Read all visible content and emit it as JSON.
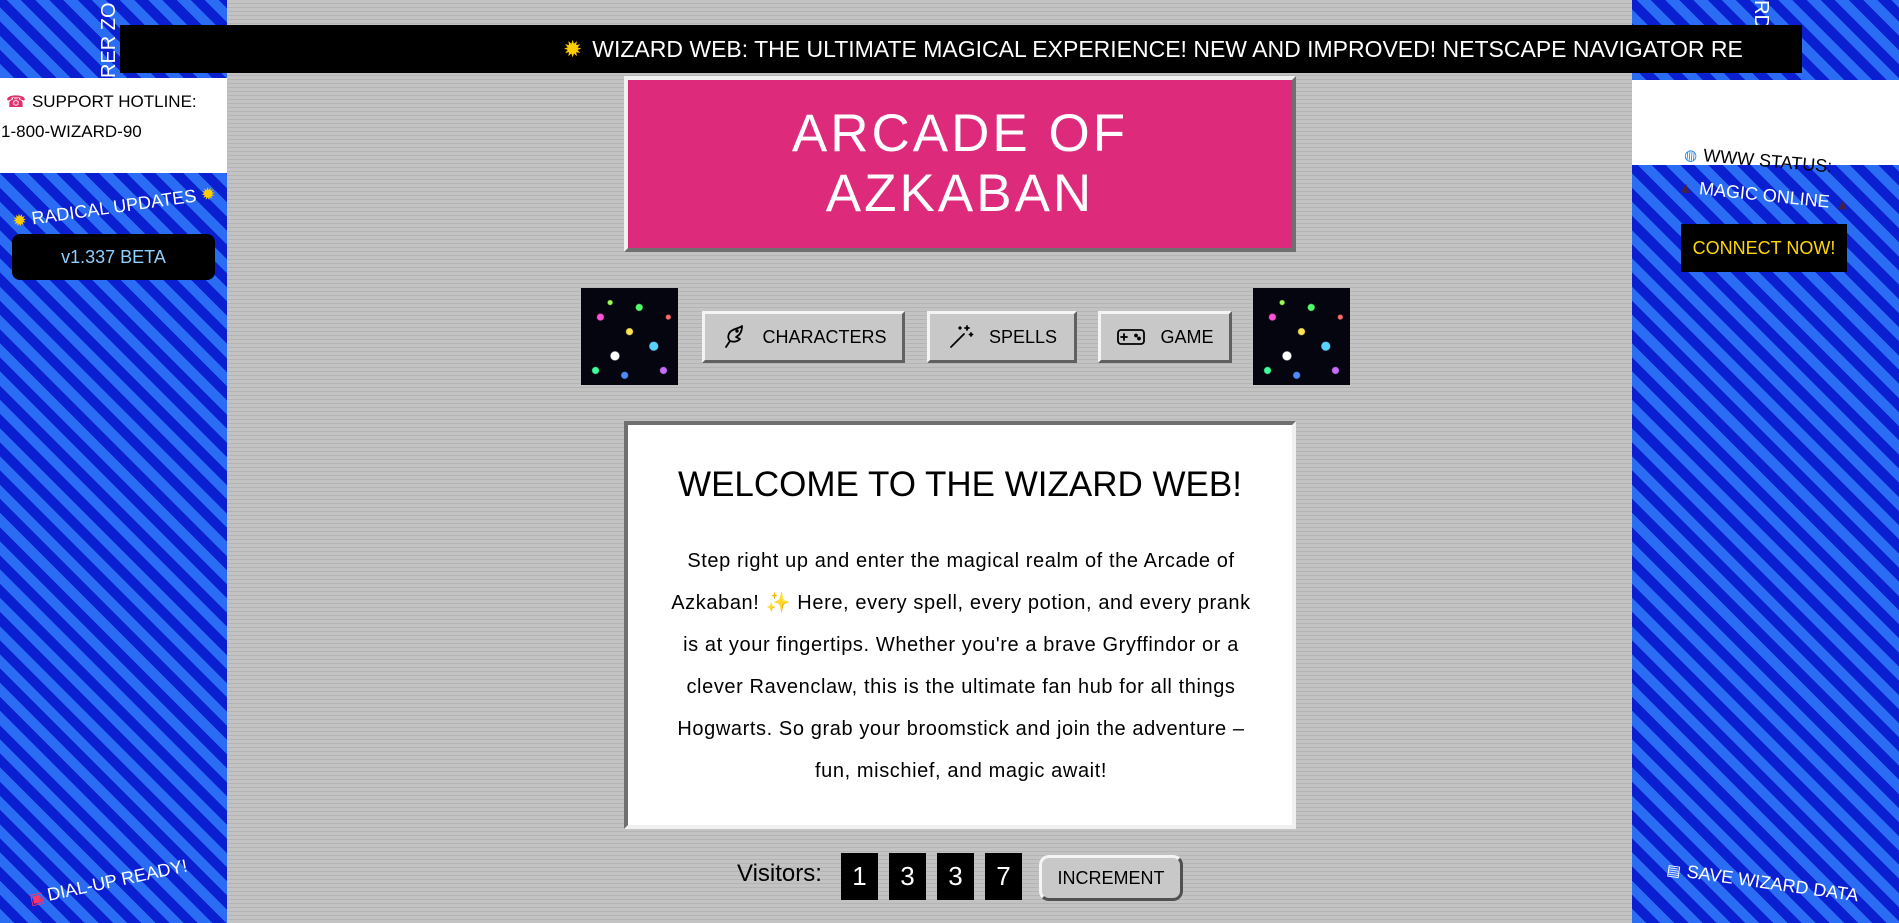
{
  "left_panel": {
    "vertical_text": "RER ZO",
    "hotline_label": "SUPPORT HOTLINE:",
    "hotline_number": "1-800-WIZARD-90",
    "radical_updates": "RADICAL UPDATES",
    "version": "v1.337 BETA",
    "dialup": "DIAL-UP READY!"
  },
  "right_panel": {
    "vertical_text": "RD",
    "www_status": "WWW STATUS:",
    "magic_online": "MAGIC ONLINE",
    "connect_label": "CONNECT NOW!",
    "save_label": "SAVE WIZARD DATA"
  },
  "marquee": {
    "text": "WIZARD WEB: THE ULTIMATE MAGICAL EXPERIENCE! NEW AND IMPROVED! NETSCAPE NAVIGATOR RE"
  },
  "header": {
    "title": "ARCADE OF AZKABAN"
  },
  "nav": {
    "items": [
      {
        "label": "CHARACTERS",
        "icon": "bird-icon"
      },
      {
        "label": "SPELLS",
        "icon": "magic-wand-icon"
      },
      {
        "label": "GAME",
        "icon": "gamepad-icon"
      }
    ]
  },
  "welcome": {
    "title": "WELCOME TO THE WIZARD WEB!",
    "body_part1": "Step right up and enter the magical realm of the Arcade of Azkaban!",
    "body_part2": "Here, every spell, every potion, and every prank is at your fingertips. Whether you're a brave Gryffindor or a clever Ravenclaw, this is the ultimate fan hub for all things Hogwarts. So grab your broomstick and join the adventure – fun, mischief, and magic await!"
  },
  "visitors": {
    "label": "Visitors:",
    "digits": [
      "1",
      "3",
      "3",
      "7"
    ],
    "increment_label": "INCREMENT"
  },
  "colors": {
    "title_bg": "#de2a7b",
    "stripe_light": "#2a6df4",
    "stripe_dark": "#0a1fd0",
    "connect_text": "#ffd700"
  }
}
